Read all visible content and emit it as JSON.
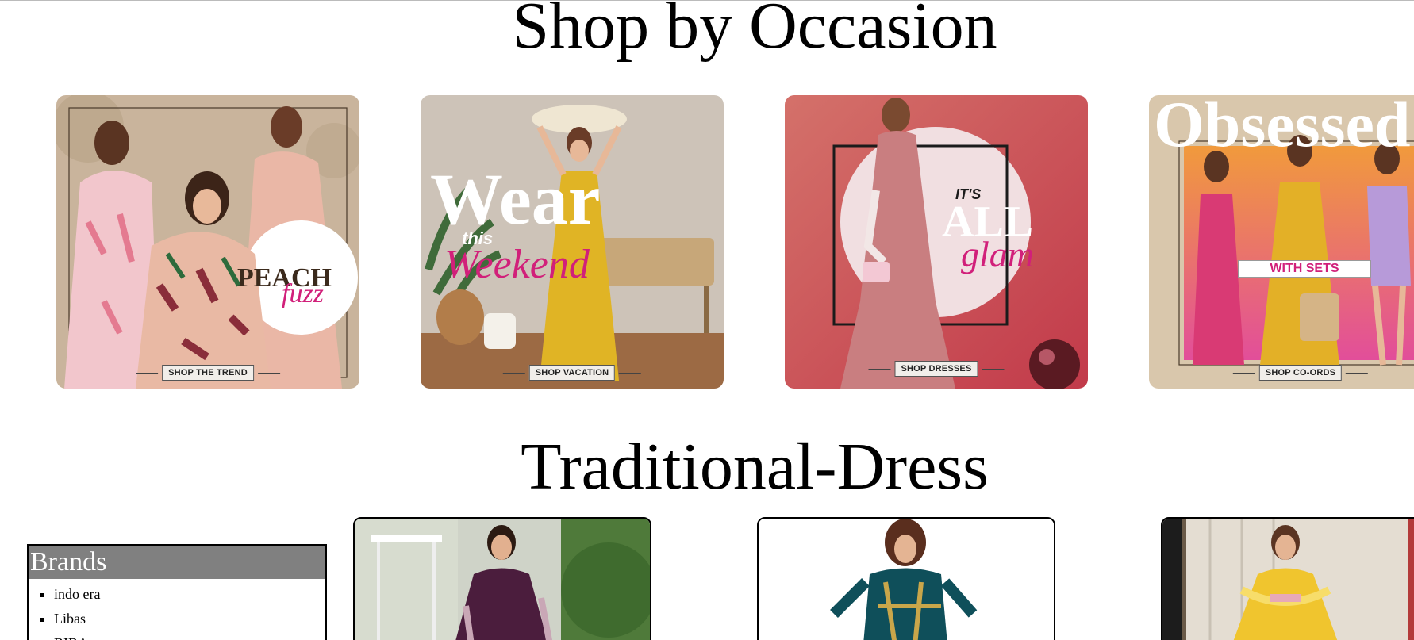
{
  "occasion": {
    "title": "Shop by Occasion",
    "cards": [
      {
        "cta": "SHOP THE TREND",
        "headline_1": "PEACH",
        "headline_2": "fuzz"
      },
      {
        "cta": "SHOP VACATION",
        "headline_1": "Wear",
        "headline_2": "this",
        "headline_3": "Weekend"
      },
      {
        "cta": "SHOP DRESSES",
        "headline_1": "IT'S",
        "headline_2": "ALL",
        "headline_3": "glam"
      },
      {
        "cta": "SHOP CO-ORDS",
        "headline_1": "Obsessed",
        "headline_2": "WITH SETS"
      }
    ]
  },
  "traditional": {
    "title": "Traditional-Dress"
  },
  "brands": {
    "heading": "Brands",
    "items": [
      "indo era",
      "Libas",
      "BIBA"
    ]
  },
  "colors": {
    "brand_header_bg": "#808080",
    "pink_accent": "#d1207a"
  }
}
